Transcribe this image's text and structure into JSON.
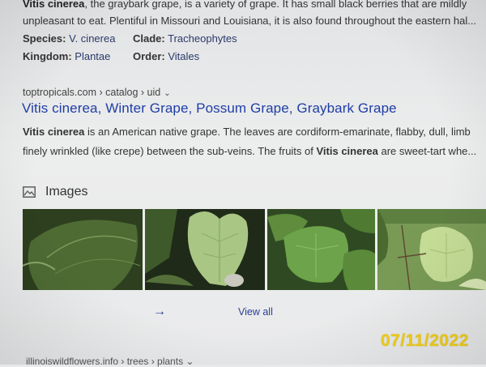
{
  "previous_result": {
    "line1_bold": "Vitis cinerea",
    "line1_rest": ", the graybark grape, is a variety of grape. It has small black berries that are mildly",
    "line2": "unpleasant to eat. Plentiful in Missouri and Louisiana, it is also found throughout the eastern hal..."
  },
  "facts": {
    "species_label": "Species:",
    "species_value": "V. cinerea",
    "clade_label": "Clade:",
    "clade_value": "Tracheophytes",
    "kingdom_label": "Kingdom:",
    "kingdom_value": "Plantae",
    "order_label": "Order:",
    "order_value": "Vitales"
  },
  "result": {
    "breadcrumb": "toptropicals.com › catalog › uid",
    "title": "Vitis cinerea, Winter Grape, Possum Grape, Graybark Grape",
    "desc_line1_bold": "Vitis cinerea",
    "desc_line1_rest": " is an American native grape. The leaves are cordiform-emarinate, flabby, dull, limb",
    "desc_line2_start": "finely wrinkled (like crepe) between the sub-veins. The fruits of ",
    "desc_line2_bold": "Vitis cinerea",
    "desc_line2_rest": " are sweet-tart whe..."
  },
  "images": {
    "heading": "Images",
    "view_all": "View all",
    "thumbnails": [
      {
        "name": "leaf-photo-1",
        "color": "#3f5a2a"
      },
      {
        "name": "leaf-photo-2",
        "color": "#8fb26a"
      },
      {
        "name": "leaf-photo-3",
        "color": "#5e8a3c"
      },
      {
        "name": "leaf-photo-4",
        "color": "#9fc070"
      }
    ]
  },
  "next_result": {
    "breadcrumb": "illinoiswildflowers.info › trees › plants"
  },
  "date_stamp": "07/11/2022",
  "colors": {
    "link": "#1f3ea6",
    "stamp": "#f3d11c"
  }
}
